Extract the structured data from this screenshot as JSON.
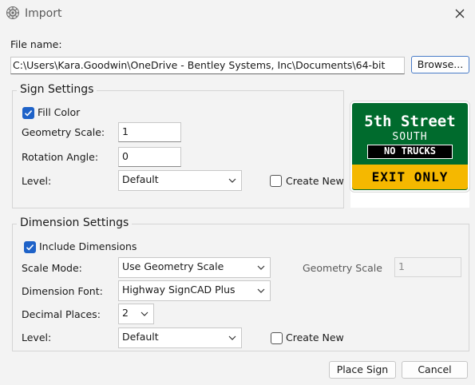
{
  "window": {
    "title": "Import",
    "icon": "gear-app-icon",
    "close_icon": "close-icon"
  },
  "file": {
    "label": "File name:",
    "value": "C:\\Users\\Kara.Goodwin\\OneDrive - Bentley Systems, Inc\\Documents\\64-bit",
    "browse_label": "Browse..."
  },
  "sign_settings": {
    "title": "Sign Settings",
    "fill_color": {
      "label": "Fill Color",
      "checked": true
    },
    "geometry_scale": {
      "label": "Geometry Scale:",
      "value": "1"
    },
    "rotation_angle": {
      "label": "Rotation Angle:",
      "value": "0"
    },
    "level": {
      "label": "Level:",
      "value": "Default"
    },
    "create_new": {
      "label": "Create New",
      "checked": false
    }
  },
  "preview": {
    "line1": "5th Street",
    "line2": "SOUTH",
    "line3": "NO TRUCKS",
    "line4": "EXIT ONLY",
    "colors": {
      "green": "#006b2d",
      "yellow": "#f5b800",
      "white": "#ffffff",
      "black": "#000000"
    }
  },
  "dimension_settings": {
    "title": "Dimension Settings",
    "include_dimensions": {
      "label": "Include Dimensions",
      "checked": true
    },
    "scale_mode": {
      "label": "Scale Mode:",
      "value": "Use Geometry Scale"
    },
    "geometry_scale": {
      "label": "Geometry Scale",
      "value": "1"
    },
    "dimension_font": {
      "label": "Dimension Font:",
      "value": "Highway SignCAD Plus"
    },
    "decimal_places": {
      "label": "Decimal Places:",
      "value": "2"
    },
    "level": {
      "label": "Level:",
      "value": "Default"
    },
    "create_new": {
      "label": "Create New",
      "checked": false
    }
  },
  "actions": {
    "place_sign_label": "Place Sign",
    "cancel_label": "Cancel"
  },
  "colors": {
    "accent": "#1e62c8",
    "window_bg": "#f3f3f3"
  }
}
